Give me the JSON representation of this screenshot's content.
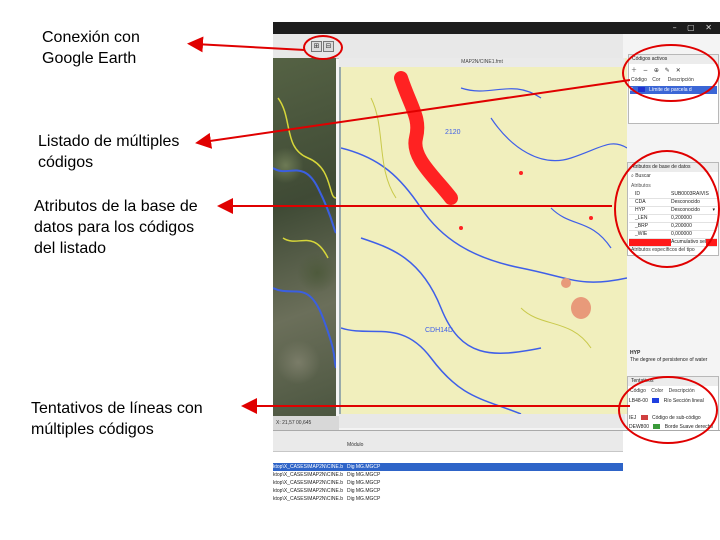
{
  "annotations": {
    "google_earth": [
      "Conexión con",
      "Google Earth"
    ],
    "multi_codes": [
      "Listado de múltiples",
      "códigos"
    ],
    "db_attributes": [
      "Atributos de la base de",
      "datos para los códigos",
      "del listado"
    ],
    "tentative_lines": [
      "Tentativos de líneas con",
      "múltiples códigos"
    ]
  },
  "app": {
    "map_tab_title": "MAP2N/CINE1.fmt",
    "map_labels": {
      "label_top": "2120",
      "label_bottom": "CDH14D"
    },
    "satellite_status": "X: 21,57 00,645"
  },
  "panel_codes": {
    "title": "Códigos activos",
    "headers": [
      "Código",
      "Cor",
      "Descripción"
    ],
    "rows": [
      {
        "code": "E",
        "color": "#2030d0",
        "desc": "Límite de parcela d"
      }
    ]
  },
  "panel_attributes": {
    "title": "Atributos de base de datos",
    "search_label": "Buscar",
    "row_header": "Atributos",
    "rows": [
      {
        "key": "ID",
        "value": "SUB0003RAIVIS"
      },
      {
        "key": "CDA",
        "value": "Desconocido"
      },
      {
        "key": "HYP",
        "value": "Desconocido"
      },
      {
        "key": "_LEN",
        "value": "0,200000"
      },
      {
        "key": "_BRP",
        "value": "0,200000"
      },
      {
        "key": "_WIE",
        "value": "0,000000"
      },
      {
        "key": "",
        "value": "Acumulativo sel"
      }
    ],
    "footer": "Atributos específicos del tipo",
    "desc_title": "HYP",
    "desc_text": "The degree of persistence of water"
  },
  "panel_tentative": {
    "title": "Tentativos",
    "headers": [
      "Código",
      "Color",
      "Descripción"
    ],
    "rows": [
      {
        "code": "LB48-00",
        "color": "#2040e0",
        "desc": "Río Sección lineal"
      },
      {
        "code": "IEJ",
        "color": "#d04040",
        "desc": "Código de sub-código"
      },
      {
        "code": "DEW800",
        "color": "#3a9a3a",
        "desc": "Borde Suave derecho"
      }
    ]
  },
  "bottom_panel": {
    "header": "Módulo",
    "rows": [
      {
        "path": "ktop\\X_CASES\\MAP2N\\CINE.bin",
        "module": "Dig MG.MGCP"
      },
      {
        "path": "ktop\\X_CASES\\MAP2N\\CINE.bin",
        "module": "Dig MG.MGCP"
      },
      {
        "path": "ktop\\X_CASES\\MAP2N\\CINE.bin",
        "module": "Dig MG.MGCP"
      },
      {
        "path": "ktop\\X_CASES\\MAP2N\\CINE.bin",
        "module": "Dig MG.MGCP"
      },
      {
        "path": "ktop\\X_CASES\\MAP2N\\CINE.bin",
        "module": "Dig MG.MGCP"
      }
    ]
  },
  "colors": {
    "annotation": "#e00000",
    "water": "#3f5fe8",
    "contour": "#c9c94a",
    "accent_red": "#ff2222"
  }
}
